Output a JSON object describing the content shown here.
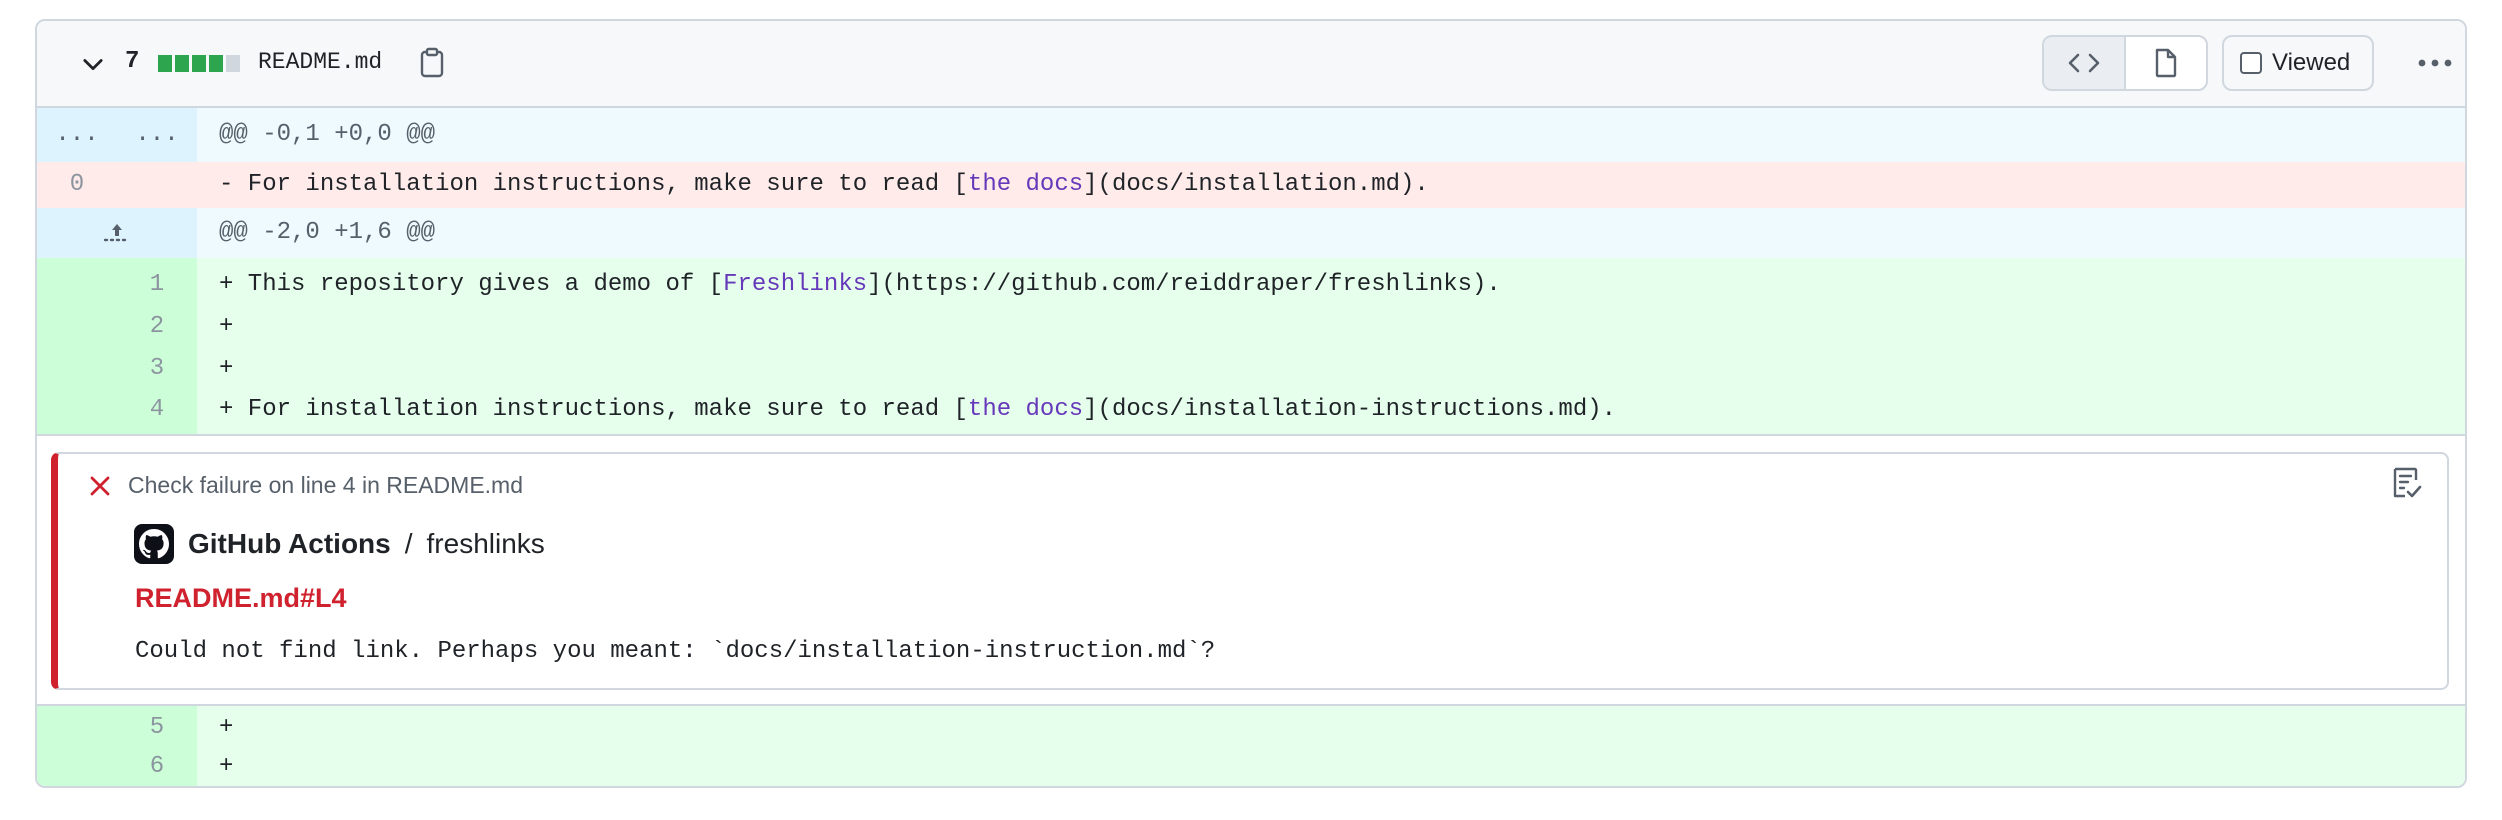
{
  "header": {
    "changes_count": "7",
    "diffstat_colors": [
      "#2da44e",
      "#2da44e",
      "#2da44e",
      "#2da44e",
      "#d0d7de"
    ],
    "filename": "README.md",
    "viewed_label": "Viewed",
    "icons": {
      "collapse": "chevron-down-icon",
      "copy": "copy-icon",
      "code_view": "code-icon",
      "file_view": "file-icon",
      "more": "kebab-horizontal-icon"
    }
  },
  "diff": {
    "hunk1": {
      "old_marker": "...",
      "new_marker": "...",
      "text": "@@ -0,1 +0,0 @@"
    },
    "deleted_line": {
      "old_num": "0",
      "prefix": "- For installation instructions, make sure to read [",
      "link_text": "the docs",
      "suffix": "](docs/installation.md)."
    },
    "hunk2": {
      "expand_icon": "expand-up-icon",
      "text": "@@ -2,0 +1,6 @@"
    },
    "added_lines": [
      {
        "num": "1",
        "prefix": "+ This repository gives a demo of [",
        "link_text": "Freshlinks",
        "suffix": "](https://github.com/reiddraper/freshlinks)."
      },
      {
        "num": "2",
        "text": "+"
      },
      {
        "num": "3",
        "text": "+"
      },
      {
        "num": "4",
        "prefix": "+ For installation instructions, make sure to read [",
        "link_text": "the docs",
        "suffix": "](docs/installation-instructions.md)."
      }
    ],
    "added_lines_after": [
      {
        "num": "5",
        "text": "+"
      },
      {
        "num": "6",
        "text": "+"
      }
    ]
  },
  "annotation": {
    "title": "Check failure on line 4 in README.md",
    "app_name": "GitHub Actions",
    "separator": "/",
    "repo": "freshlinks",
    "link": "README.md#L4",
    "message": "Could not find link. Perhaps you meant: `docs/installation-instruction.md`?",
    "colors": {
      "failure": "#cf222e"
    }
  }
}
